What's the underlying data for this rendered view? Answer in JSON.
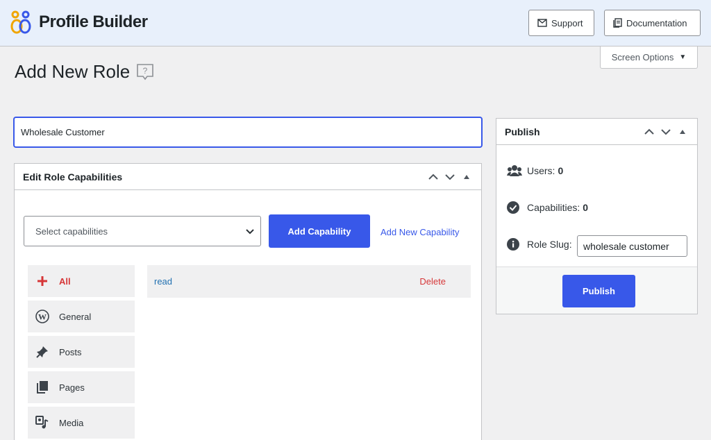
{
  "app": {
    "brand": "Profile Builder"
  },
  "header": {
    "support_label": "Support",
    "documentation_label": "Documentation"
  },
  "screen_options": {
    "label": "Screen Options"
  },
  "page": {
    "title": "Add New Role"
  },
  "role_name": {
    "value": "Wholesale Customer"
  },
  "capabilities_box": {
    "title": "Edit Role Capabilities",
    "select_placeholder": "Select capabilities",
    "add_button": "Add Capability",
    "add_new_link": "Add New Capability",
    "categories": [
      {
        "label": "All",
        "icon": "plus-icon"
      },
      {
        "label": "General",
        "icon": "wordpress-icon"
      },
      {
        "label": "Posts",
        "icon": "pin-icon"
      },
      {
        "label": "Pages",
        "icon": "pages-icon"
      },
      {
        "label": "Media",
        "icon": "media-icon"
      }
    ],
    "capability_rows": [
      {
        "name": "read",
        "delete_label": "Delete"
      }
    ]
  },
  "publish_box": {
    "title": "Publish",
    "users_label": "Users:",
    "users_count": "0",
    "capabilities_label": "Capabilities:",
    "capabilities_count": "0",
    "slug_label": "Role Slug:",
    "slug_value": "wholesale customer",
    "publish_button": "Publish"
  },
  "colors": {
    "accent": "#3858e9",
    "danger": "#d63638",
    "link": "#2271b1",
    "header_bg": "#e8f0fb"
  }
}
